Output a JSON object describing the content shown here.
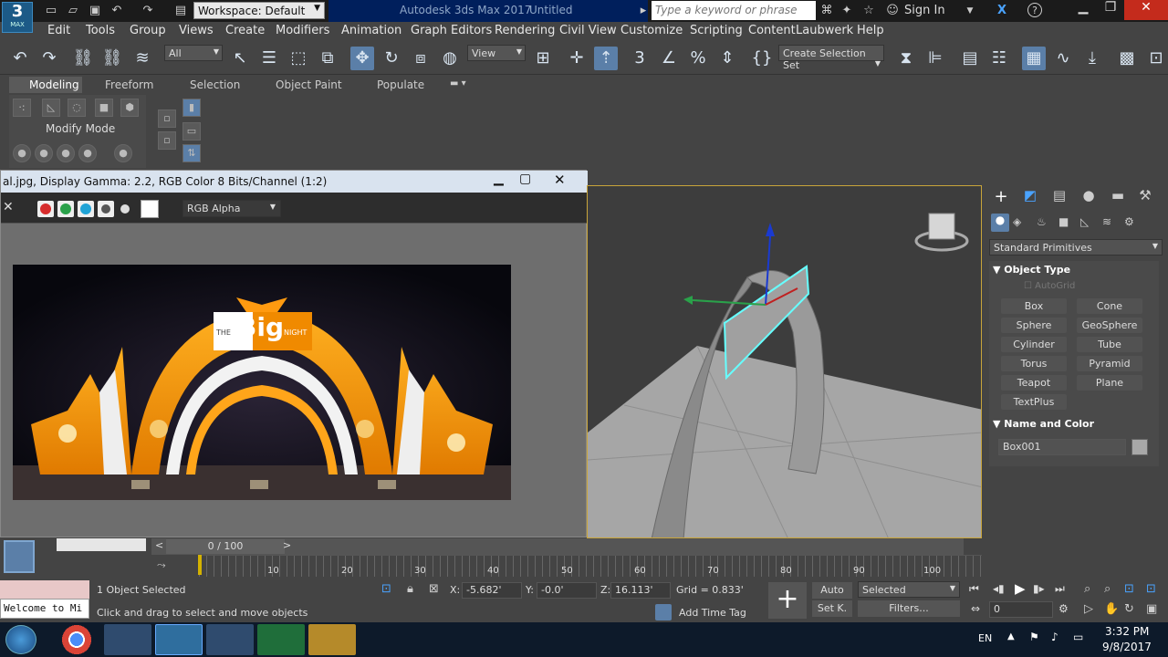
{
  "titlebar": {
    "logo_main": "3",
    "logo_sub": "MAX",
    "workspace": "Workspace: Default",
    "app_title": "Autodesk 3ds Max 2017",
    "doc_title": "Untitled",
    "search_placeholder": "Type a keyword or phrase",
    "sign_in": "Sign In"
  },
  "menu": [
    "Edit",
    "Tools",
    "Group",
    "Views",
    "Create",
    "Modifiers",
    "Animation",
    "Graph Editors",
    "Rendering",
    "Civil View",
    "Customize",
    "Scripting",
    "Content",
    "Laubwerk",
    "Help"
  ],
  "toolbar": {
    "filter_value": "All",
    "refcoord_value": "View",
    "selset_value": "Create Selection Set"
  },
  "ribbon": {
    "tabs": [
      "Modeling",
      "Freeform",
      "Selection",
      "Object Paint",
      "Populate"
    ],
    "modify_mode": "Modify Mode"
  },
  "frame_window": {
    "title": "al.jpg, Display Gamma: 2.2, RGB Color 8 Bits/Channel (1:2)",
    "channel": "RGB Alpha",
    "logo_the": "THE",
    "logo_big": "Big",
    "logo_night": "NIGHT"
  },
  "command_panel": {
    "category": "Standard Primitives",
    "object_type_header": "Object Type",
    "autogrid": "AutoGrid",
    "buttons": [
      "Box",
      "Cone",
      "Sphere",
      "GeoSphere",
      "Cylinder",
      "Tube",
      "Torus",
      "Pyramid",
      "Teapot",
      "Plane",
      "TextPlus"
    ],
    "name_color_header": "Name and Color",
    "object_name": "Box001"
  },
  "timeline": {
    "frame_counter": "0 / 100",
    "ticks": [
      "10",
      "20",
      "30",
      "40",
      "50",
      "60",
      "70",
      "80",
      "90",
      "100"
    ]
  },
  "status": {
    "maxscript_text": "Welcome to Mi",
    "selected_count": "1 Object Selected",
    "prompt": "Click and drag to select and move objects",
    "x_label": "X:",
    "x_value": "-5.682'",
    "y_label": "Y:",
    "y_value": "-0.0'",
    "z_label": "Z:",
    "z_value": "16.113'",
    "grid": "Grid = 0.833'",
    "add_time_tag": "Add Time Tag",
    "auto": "Auto",
    "set_key": "Set K.",
    "key_mode": "Selected",
    "filters": "Filters...",
    "frame_field": "0"
  },
  "taskbar": {
    "lang": "EN",
    "time": "3:32 PM",
    "date": "9/8/2017"
  },
  "colors": {
    "accent_blue": "#4aa3ff",
    "viewport_border": "#c9a53a",
    "selection_cyan": "#6ff"
  }
}
